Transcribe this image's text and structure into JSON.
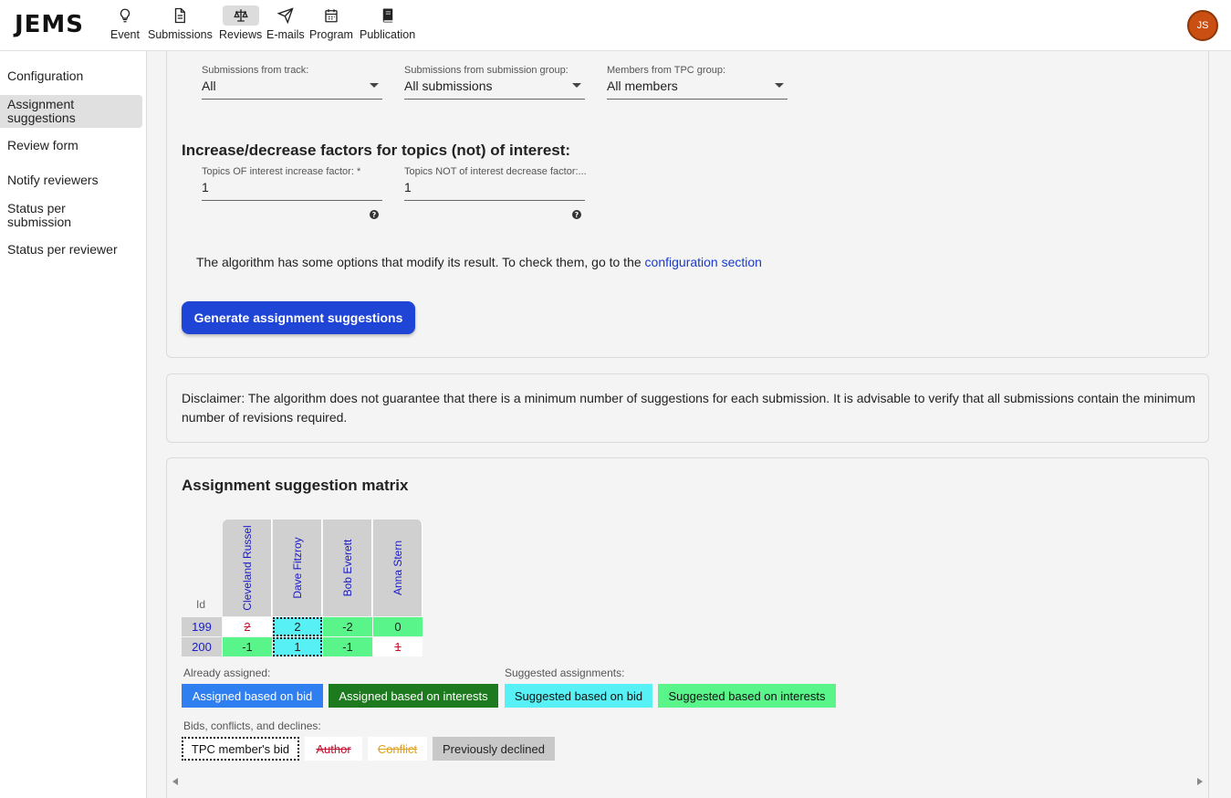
{
  "app": {
    "logo": "JEMS",
    "avatar_initials": "JS"
  },
  "nav": [
    {
      "label": "Event",
      "icon": "lightbulb-icon"
    },
    {
      "label": "Submissions",
      "icon": "document-icon"
    },
    {
      "label": "Reviews",
      "icon": "scale-icon",
      "active": true
    },
    {
      "label": "E-mails",
      "icon": "paper-plane-icon"
    },
    {
      "label": "Program",
      "icon": "calendar-icon"
    },
    {
      "label": "Publication",
      "icon": "book-icon"
    }
  ],
  "sidebar": {
    "items": [
      {
        "label": "Configuration"
      },
      {
        "label": "Assignment suggestions",
        "active": true
      },
      {
        "label": "Review form"
      },
      {
        "label": "Notify reviewers"
      },
      {
        "label": "Status per submission"
      },
      {
        "label": "Status per reviewer"
      }
    ]
  },
  "filters": {
    "track": {
      "label": "Submissions from track:",
      "value": "All"
    },
    "group": {
      "label": "Submissions from submission group:",
      "value": "All submissions"
    },
    "tpc": {
      "label": "Members from TPC group:",
      "value": "All members"
    }
  },
  "factors": {
    "title": "Increase/decrease factors for topics (not) of interest:",
    "increase": {
      "label": "Topics OF interest increase factor: *",
      "value": "1"
    },
    "decrease": {
      "label": "Topics NOT of interest decrease factor:...",
      "value": "1"
    }
  },
  "algorithm_note": {
    "text": "The algorithm has some options that modify its result. To check them, go to the ",
    "link": "configuration section"
  },
  "generate_button": "Generate assignment suggestions",
  "disclaimer": "Disclaimer: The algorithm does not guarantee that there is a minimum number of suggestions for each submission. It is advisable to verify that all submissions contain the minimum number of revisions required.",
  "matrix": {
    "title": "Assignment suggestion matrix",
    "id_header": "Id",
    "reviewers": [
      "Cleveland Russel",
      "Dave Fitzroy",
      "Bob Everett",
      "Anna Stern"
    ],
    "rows": [
      {
        "id": "199",
        "cells": [
          {
            "value": "2",
            "style": "author"
          },
          {
            "value": "2",
            "style": "bid-suggested"
          },
          {
            "value": "-2",
            "style": "interest-suggested"
          },
          {
            "value": "0",
            "style": "interest-suggested"
          }
        ]
      },
      {
        "id": "200",
        "cells": [
          {
            "value": "-1",
            "style": "interest-suggested"
          },
          {
            "value": "1",
            "style": "bid-suggested"
          },
          {
            "value": "-1",
            "style": "interest-suggested"
          },
          {
            "value": "1",
            "style": "author"
          }
        ]
      }
    ]
  },
  "legend": {
    "already_label": "Already assigned:",
    "suggested_label": "Suggested assignments:",
    "bids_label": "Bids, conflicts, and declines:",
    "assigned_bid": "Assigned based on bid",
    "assigned_interests": "Assigned based on interests",
    "suggested_bid": "Suggested based on bid",
    "suggested_interests": "Suggested based on interests",
    "tpc_bid": "TPC member's bid",
    "author": "Author",
    "conflict": "Conflict",
    "declined": "Previously declined"
  },
  "colors": {
    "primary": "#1f45d6",
    "assigned_bid": "#2f7ff0",
    "assigned_interests": "#1e7a1e",
    "suggested_bid": "#57f0f4",
    "suggested_interests": "#5af58a",
    "declined": "#c8c8c8",
    "author_text": "#c8102e",
    "conflict_text": "#e0a020"
  }
}
